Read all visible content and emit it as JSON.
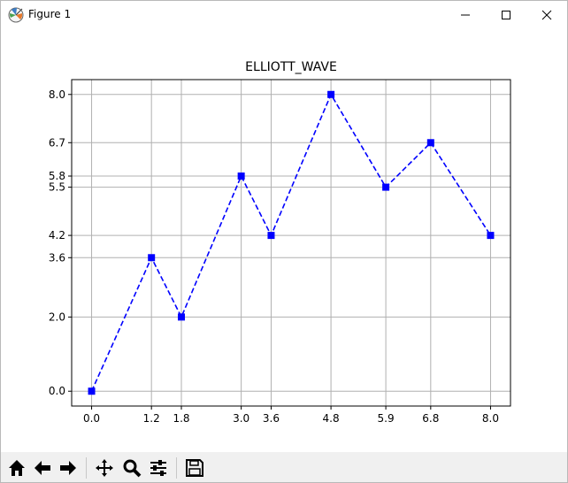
{
  "window": {
    "title": "Figure 1",
    "controls": [
      "minimize",
      "maximize",
      "close"
    ]
  },
  "chart_data": {
    "type": "line",
    "title": "ELLIOTT_WAVE",
    "xlabel": "",
    "ylabel": "",
    "x": [
      0.0,
      1.2,
      1.8,
      3.0,
      3.6,
      4.8,
      5.9,
      6.8,
      8.0
    ],
    "y": [
      0.0,
      3.6,
      2.0,
      5.8,
      4.2,
      8.0,
      5.5,
      6.7,
      4.2
    ],
    "x_tick_labels": [
      "0.0",
      "1.2",
      "1.8",
      "3.0",
      "3.6",
      "4.8",
      "5.9",
      "6.8",
      "8.0"
    ],
    "y_tick_values": [
      0.0,
      2.0,
      3.6,
      4.2,
      5.5,
      5.8,
      6.7,
      8.0
    ],
    "y_tick_labels": [
      "0.0",
      "2.0",
      "3.6",
      "4.2",
      "5.5",
      "5.8",
      "6.7",
      "8.0"
    ],
    "xlim": [
      -0.4,
      8.4
    ],
    "ylim": [
      -0.4,
      8.4
    ],
    "grid": true,
    "line_style": "dashed",
    "marker": "square",
    "color": "#0000ff"
  },
  "toolbar": {
    "buttons": [
      "home-icon",
      "back-arrow-icon",
      "forward-arrow-icon",
      "pan-move-icon",
      "zoom-magnifier-icon",
      "configure-subplots-icon",
      "save-floppy-icon"
    ]
  }
}
